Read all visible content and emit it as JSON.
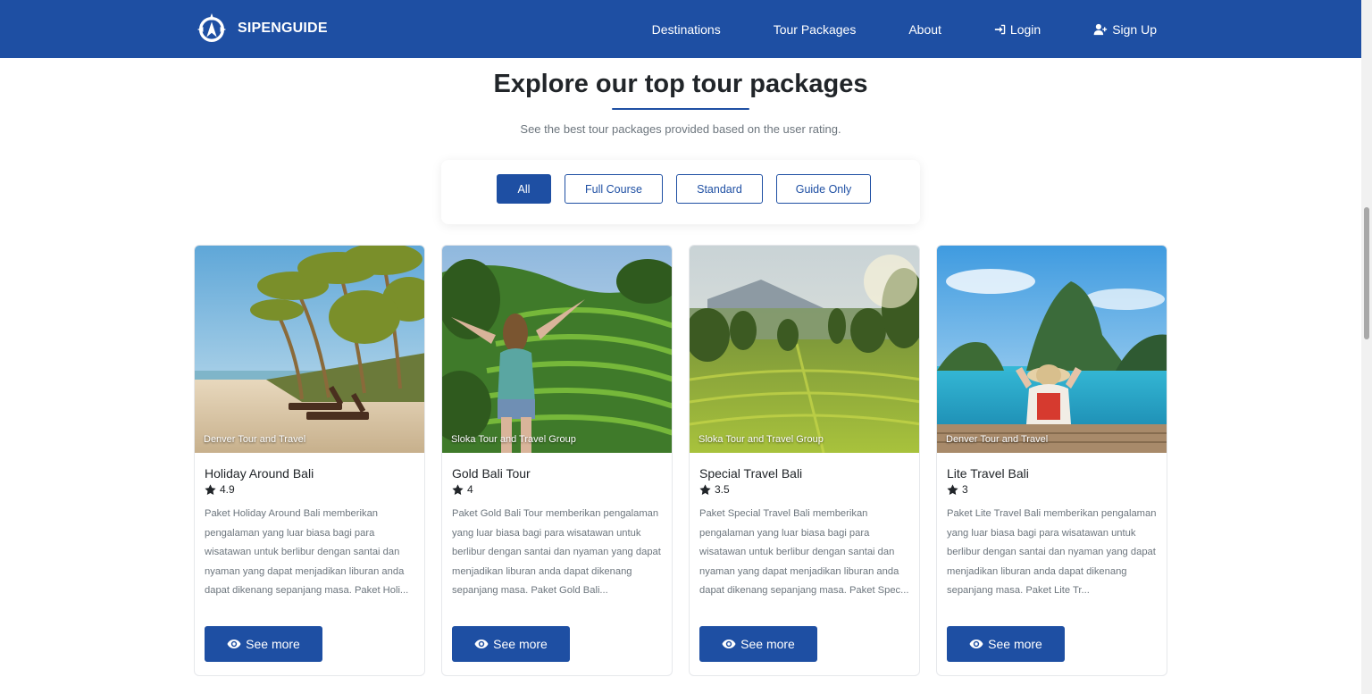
{
  "brand": {
    "name": "SIPENGUIDE",
    "logo_icon": "compass-logo-icon"
  },
  "nav": {
    "destinations": "Destinations",
    "tour_packages": "Tour Packages",
    "about": "About",
    "login": "Login",
    "signup": "Sign Up"
  },
  "section": {
    "title": "Explore our top tour packages",
    "subtitle": "See the best tour packages provided based on the user rating."
  },
  "filters": [
    "All",
    "Full Course",
    "Standard",
    "Guide Only"
  ],
  "active_filter": "All",
  "cards": [
    {
      "agency": "Denver Tour and Travel",
      "title": "Holiday Around Bali",
      "rating": "4.9",
      "description": "Paket Holiday Around Bali memberikan pengalaman yang luar biasa bagi para wisatawan untuk berlibur dengan santai dan nyaman yang dapat menjadikan liburan anda dapat dikenang sepanjang masa. Paket Holi...",
      "button": "See more"
    },
    {
      "agency": "Sloka Tour and Travel Group",
      "title": "Gold Bali Tour",
      "rating": "4",
      "description": "Paket Gold Bali Tour memberikan pengalaman yang luar biasa bagi para wisatawan untuk berlibur dengan santai dan nyaman yang dapat menjadikan liburan anda dapat dikenang sepanjang masa. Paket Gold Bali...",
      "button": "See more"
    },
    {
      "agency": "Sloka Tour and Travel Group",
      "title": "Special Travel Bali",
      "rating": "3.5",
      "description": "Paket Special Travel Bali memberikan pengalaman yang luar biasa bagi para wisatawan untuk berlibur dengan santai dan nyaman yang dapat menjadikan liburan anda dapat dikenang sepanjang masa. Paket Spec...",
      "button": "See more"
    },
    {
      "agency": "Denver Tour and Travel",
      "title": "Lite Travel Bali",
      "rating": "3",
      "description": "Paket Lite Travel Bali memberikan pengalaman yang luar biasa bagi para wisatawan untuk berlibur dengan santai dan nyaman yang dapat menjadikan liburan anda dapat dikenang sepanjang masa. Paket Lite Tr...",
      "button": "See more"
    }
  ],
  "colors": {
    "primary": "#1e4fa3",
    "muted_text": "#6c757d"
  }
}
